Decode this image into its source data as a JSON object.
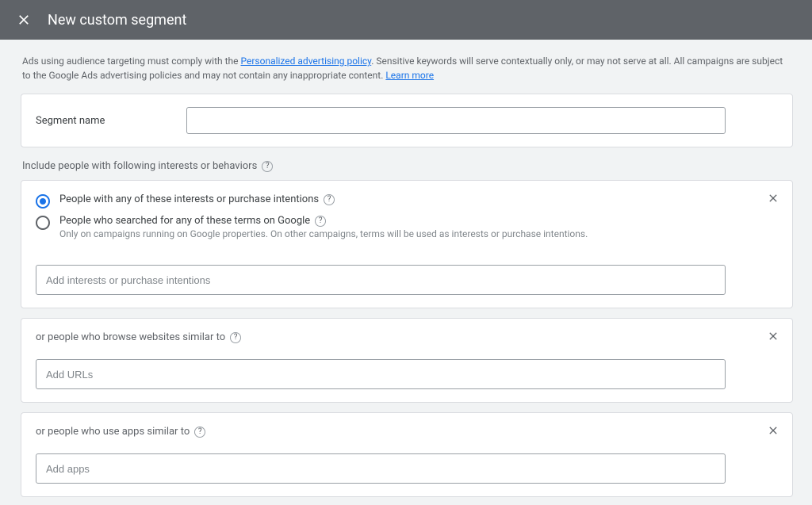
{
  "header": {
    "title": "New custom segment"
  },
  "policy": {
    "prefix": "Ads using audience targeting must comply with the ",
    "link1": "Personalized advertising policy",
    "middle": ". Sensitive keywords will serve contextually only, or may not serve at all. All campaigns are subject to the Google Ads advertising policies and may not contain any inappropriate content. ",
    "link2": "Learn more"
  },
  "segment": {
    "label": "Segment name",
    "value": ""
  },
  "include_label": "Include people with following interests or behaviors",
  "interests": {
    "radio1": "People with any of these interests or purchase intentions",
    "radio2": "People who searched for any of these terms on Google",
    "radio2_sub": "Only on campaigns running on Google properties. On other campaigns, terms will be used as interests or purchase intentions.",
    "placeholder": "Add interests or purchase intentions"
  },
  "websites": {
    "heading": "or people who browse websites similar to",
    "placeholder": "Add URLs"
  },
  "apps": {
    "heading": "or people who use apps similar to",
    "placeholder": "Add apps"
  }
}
